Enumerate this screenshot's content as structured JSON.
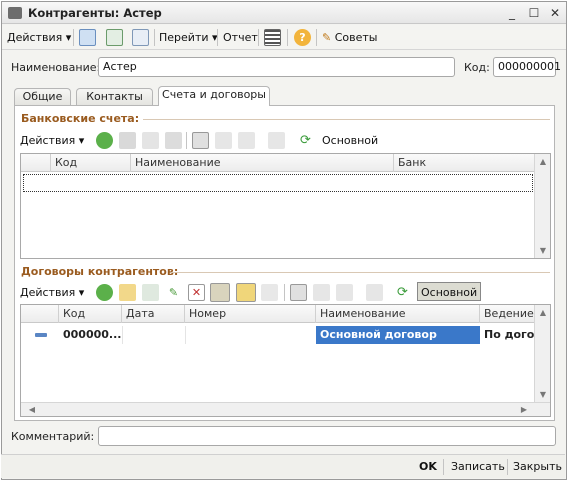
{
  "window": {
    "title": "Контрагенты: Астер",
    "min": "_",
    "max": "☐",
    "close": "✕"
  },
  "toolbar": {
    "actions": "Действия",
    "goto": "Перейти",
    "report": "Отчет",
    "tips": "Советы",
    "help": "?"
  },
  "form": {
    "name_label": "Наименование:",
    "name_value": "Астер",
    "code_label": "Код:",
    "code_value": "000000001"
  },
  "tabs": [
    {
      "label": "Общие"
    },
    {
      "label": "Контакты"
    },
    {
      "label": "Счета и договоры"
    }
  ],
  "bank": {
    "title": "Банковские счета:",
    "actions": "Действия",
    "main_btn": "Основной",
    "columns": [
      "Код",
      "Наименование",
      "Банк"
    ]
  },
  "contracts": {
    "title": "Договоры контрагентов:",
    "actions": "Действия",
    "main_btn": "Основной",
    "columns": [
      "Код",
      "Дата",
      "Номер",
      "Наименование",
      "Ведение"
    ],
    "rows": [
      {
        "code": "000000...",
        "date": "",
        "number": "",
        "name": "Основной договор",
        "mode": "По дого"
      }
    ]
  },
  "comment": {
    "label": "Комментарий:",
    "value": ""
  },
  "footer": {
    "ok": "OK",
    "write": "Записать",
    "close": "Закрыть"
  },
  "colors": {
    "section": "#9a5b1f",
    "selected": "#3a78c9"
  }
}
